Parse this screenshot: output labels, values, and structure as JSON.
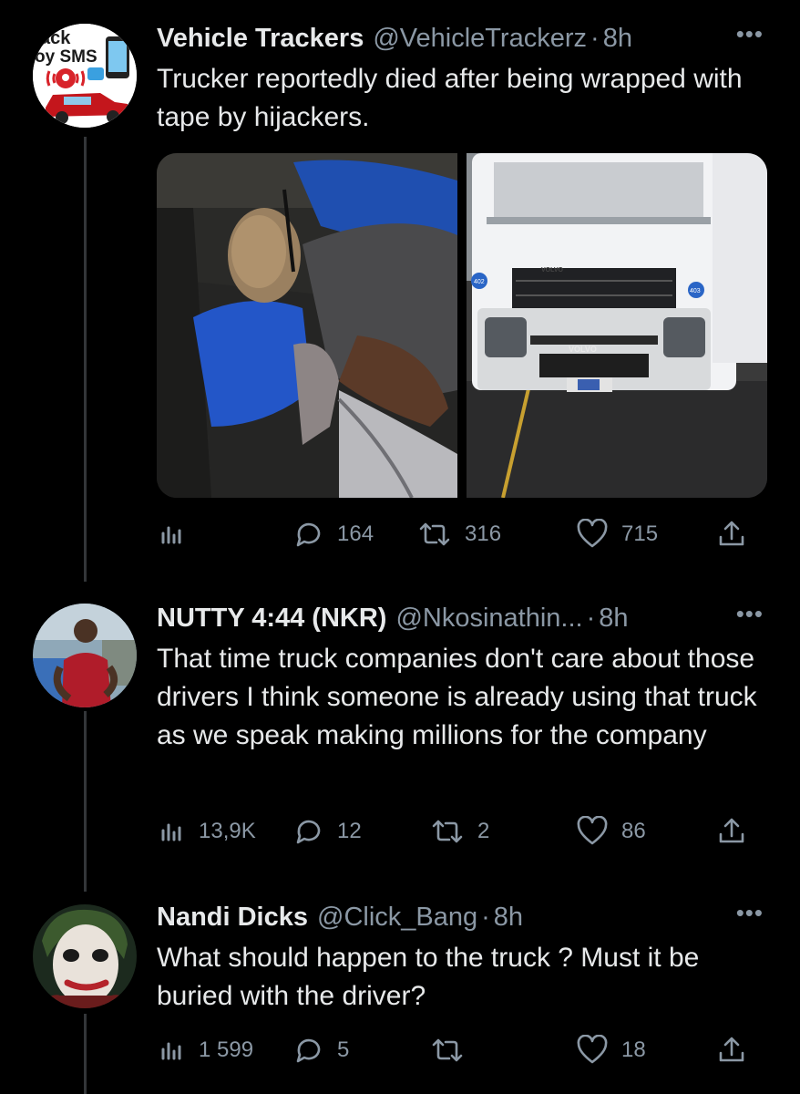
{
  "tweets": [
    {
      "name": "Vehicle Trackers",
      "handle": "@VehicleTrackerz",
      "time": "8h",
      "text": "Trucker reportedly died after being wrapped with tape by hijackers.",
      "avatar_text": [
        "ack",
        "oy SMS"
      ],
      "actions": {
        "views": "",
        "replies": "164",
        "retweets": "316",
        "likes": "715"
      }
    },
    {
      "name": "NUTTY 4:44 (NKR)",
      "handle": "@Nkosinathin...",
      "time": "8h",
      "text": "That time truck companies don't care about those drivers I think someone is already using that truck as we speak making millions for the company",
      "actions": {
        "views": "13,9K",
        "replies": "12",
        "retweets": "2",
        "likes": "86"
      }
    },
    {
      "name": "Nandi Dicks",
      "handle": "@Click_Bang",
      "time": "8h",
      "text": "What should happen to the truck ? Must it be buried with the driver?",
      "actions": {
        "views": "1 599",
        "replies": "5",
        "retweets": "",
        "likes": "18"
      }
    }
  ],
  "truck_brand": "VOLVO",
  "truck_numbers": [
    "402",
    "403"
  ],
  "icons": {
    "views": "bar-chart-icon",
    "reply": "speech-bubble-icon",
    "retweet": "retweet-arrows-icon",
    "like": "heart-icon",
    "share": "share-upload-icon",
    "more": "more-dots-icon"
  }
}
